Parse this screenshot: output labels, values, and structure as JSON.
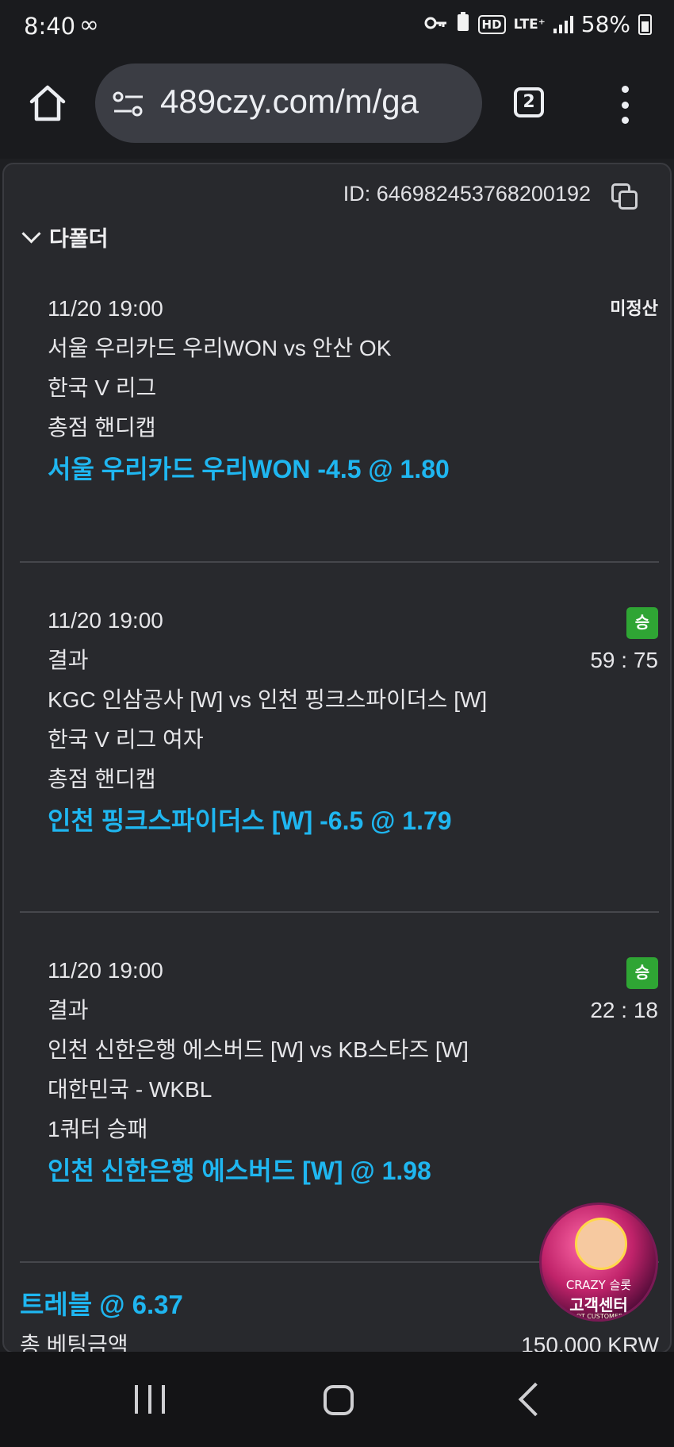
{
  "status_bar": {
    "time": "8:40",
    "infinity_icon": "∞",
    "hd": "HD",
    "lte": "LTE⁺",
    "battery": "58%"
  },
  "browser": {
    "url": "489czy.com/m/ga",
    "tab_count": "2"
  },
  "ticket": {
    "id_text": "ID: 646982453768200192",
    "section_title": "다폴더"
  },
  "bets": [
    {
      "datetime": "11/20 19:00",
      "status": "미정산",
      "match": "서울 우리카드 우리WON vs 안산 OK",
      "league": "한국 V 리그",
      "market": "총점 핸디캡",
      "pick": "서울 우리카드 우리WON -4.5 @ 1.80"
    },
    {
      "datetime": "11/20 19:00",
      "status": "승",
      "result_label": "결과",
      "score": "59 : 75",
      "match": "KGC 인삼공사 [W] vs 인천 핑크스파이더스 [W]",
      "league": "한국 V 리그 여자",
      "market": "총점 핸디캡",
      "pick": "인천 핑크스파이더스 [W] -6.5 @ 1.79"
    },
    {
      "datetime": "11/20 19:00",
      "status": "승",
      "result_label": "결과",
      "score": "22 : 18",
      "match": "인천 신한은행 에스버드 [W] vs KB스타즈 [W]",
      "league": "대한민국 - WKBL",
      "market": "1쿼터 승패",
      "pick": "인천 신한은행 에스버드 [W] @ 1.98"
    }
  ],
  "summary": {
    "title": "트레블 @ 6.37",
    "stake_label": "총 베팅금액",
    "stake_value": "150,000 KRW"
  },
  "support_badge": {
    "brand": "CRAZY 슬롯",
    "label": "고객센터",
    "sub": "CRAZY SLOT CUSTOMER SERVICE"
  },
  "colors": {
    "accent": "#1fb6f0",
    "win_badge": "#2fa534",
    "card_bg": "#28292d"
  }
}
